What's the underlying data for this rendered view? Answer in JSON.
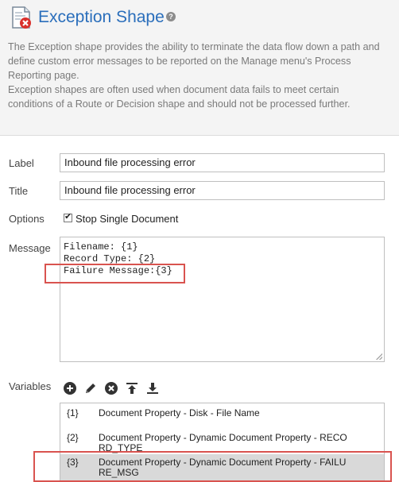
{
  "title": "Exception Shape",
  "description": [
    "The Exception shape provides the ability to terminate the data flow down a path and",
    "define custom error messages to be reported on the Manage menu's Process",
    "Reporting page.",
    "Exception shapes are often used when document data fails to meet certain",
    "conditions of a Route or Decision shape and should not be processed further."
  ],
  "form": {
    "label_label": "Label",
    "label_value": "Inbound file processing error",
    "title_label": "Title",
    "title_value": "Inbound file processing error",
    "options_label": "Options",
    "stop_single_document": "Stop Single Document",
    "stop_single_document_checked": true,
    "message_label": "Message",
    "message_lines": [
      "Filename: {1}",
      "Record Type: {2}",
      "Failure Message:{3}"
    ],
    "variables_label": "Variables"
  },
  "variables": [
    {
      "key": "{1}",
      "line1": "Document Property - Disk - File Name",
      "line2": ""
    },
    {
      "key": "{2}",
      "line1": "Document Property - Dynamic Document Property - RECO",
      "line2": "RD_TYPE"
    },
    {
      "key": "{3}",
      "line1": "Document Property - Dynamic Document Property - FAILU",
      "line2": "RE_MSG"
    }
  ],
  "icons": {
    "shape": "exception-shape-icon",
    "help": "help-icon",
    "add": "add-icon",
    "edit": "pencil-icon",
    "remove": "remove-icon",
    "move_top": "move-to-top-icon",
    "move_bottom": "move-to-bottom-icon"
  },
  "colors": {
    "title": "#2a6ebb",
    "highlight": "#d9534f",
    "selected_row": "#d9d9d9"
  }
}
